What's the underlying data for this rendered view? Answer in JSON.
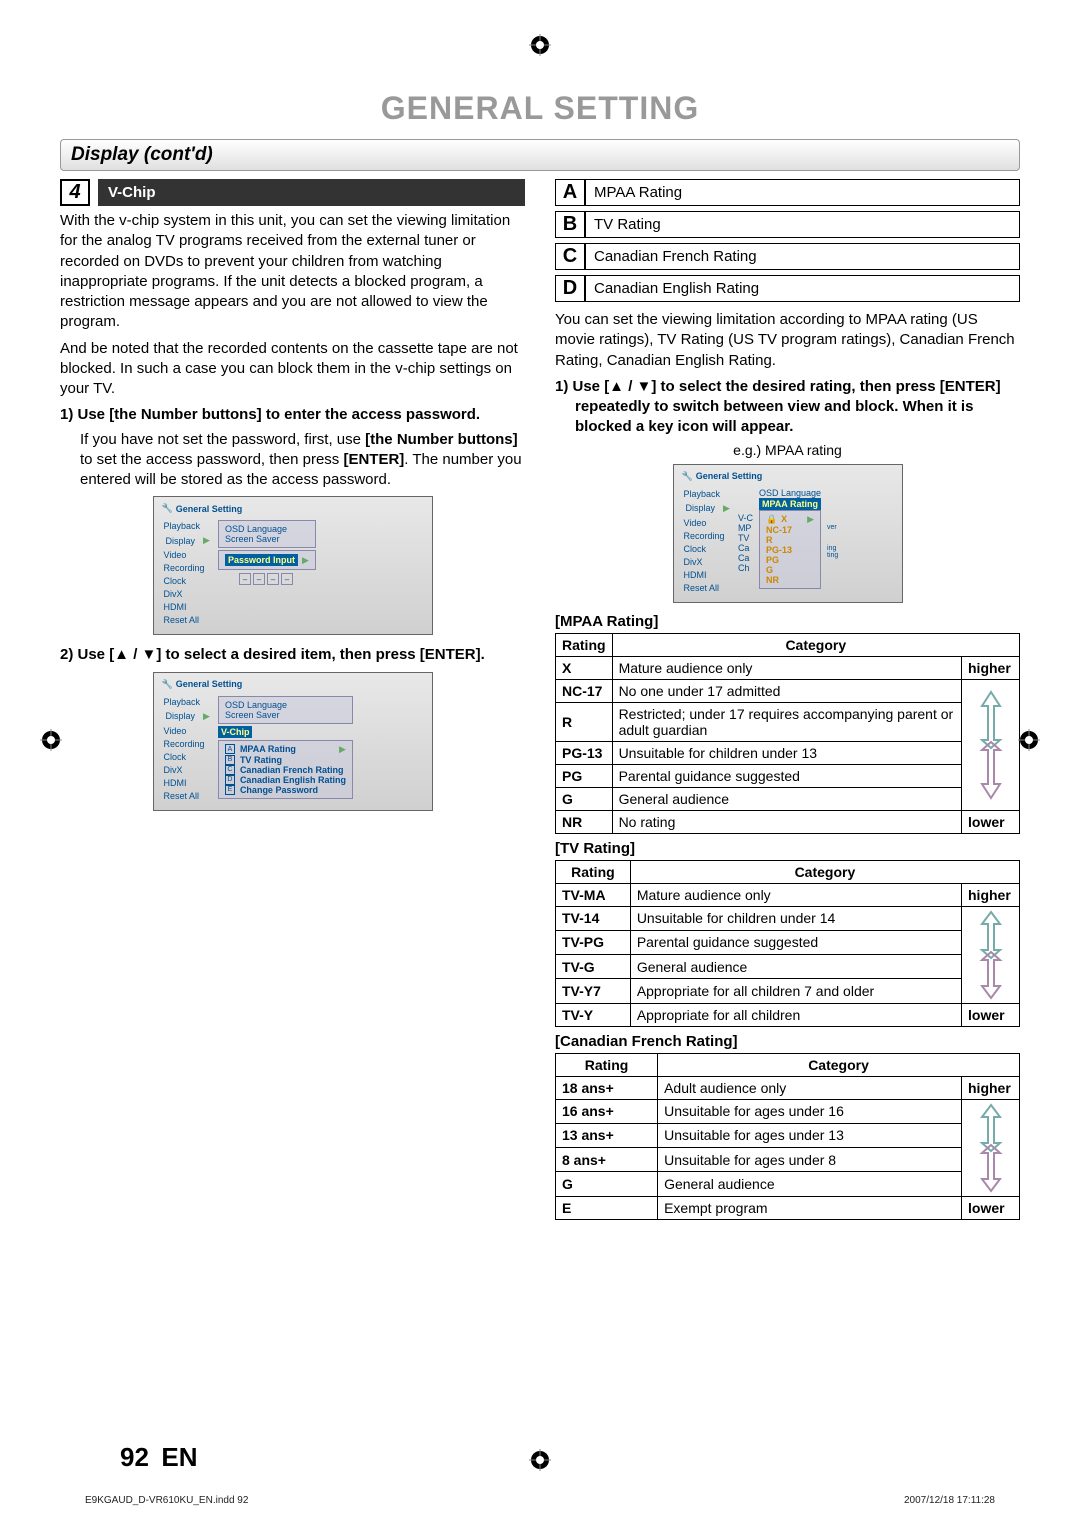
{
  "header": {
    "title": "GENERAL SETTING"
  },
  "section": {
    "title": "Display (cont'd)"
  },
  "step4": {
    "number": "4",
    "label": "V-Chip",
    "para1": "With the v-chip system in this unit, you can set the viewing limitation for the analog TV programs received from the external tuner or recorded on DVDs to prevent your children from watching inappropriate programs. If the unit detects a blocked program, a restriction message appears and you are not allowed to view the program.",
    "para2": "And be noted that the recorded contents on the cassette tape are not blocked. In such a case you can block them in the v-chip settings on your TV.",
    "step1": "1) Use [the Number buttons] to enter the access password.",
    "step1_body_a": "If you have not set the password, first, use ",
    "step1_body_b": "[the Number buttons]",
    "step1_body_c": " to set the access password, then press ",
    "step1_body_d": "[ENTER]",
    "step1_body_e": ". The number you entered will be stored as the access password.",
    "step2": "2) Use [▲ / ▼] to select a desired item, then press [ENTER]."
  },
  "osd": {
    "window": "General Setting",
    "menu": [
      "Playback",
      "Display",
      "Video",
      "Recording",
      "Clock",
      "DivX",
      "HDMI",
      "Reset All"
    ],
    "side": [
      "OSD Language",
      "Screen Saver"
    ],
    "pw_label": "Password Input",
    "vchip_label": "V-Chip",
    "vchip_items": [
      "MPAA Rating",
      "TV Rating",
      "Canadian French Rating",
      "Canadian English Rating",
      "Change Password"
    ],
    "letters": [
      "A",
      "B",
      "C",
      "D",
      "E"
    ],
    "mpaa_hl": "MPAA Rating",
    "mpaa_list": [
      "X",
      "NC-17",
      "R",
      "PG-13",
      "PG",
      "G",
      "NR"
    ],
    "mpaa_trunc": [
      "MP",
      "TV",
      "Ca",
      "Ca",
      "Ch"
    ],
    "trunc_right": [
      "ver",
      "ing",
      "ting"
    ]
  },
  "options": {
    "A": "MPAA Rating",
    "B": "TV Rating",
    "C": "Canadian French Rating",
    "D": "Canadian English Rating"
  },
  "right": {
    "para": "You can set the viewing limitation according to MPAA rating (US movie ratings), TV Rating (US TV program ratings), Canadian French Rating, Canadian English Rating.",
    "step": "1) Use [▲ / ▼] to select the desired rating, then press [ENTER] repeatedly to switch between view and block. When it is blocked a key icon will appear.",
    "eg": "e.g.) MPAA rating"
  },
  "tables": {
    "mpaa_title": "[MPAA Rating]",
    "tv_title": "[TV Rating]",
    "cfr_title": "[Canadian French Rating]",
    "headers": {
      "rating": "Rating",
      "category": "Category"
    },
    "higher": "higher",
    "lower": "lower",
    "mpaa": [
      {
        "r": "X",
        "c": "Mature audience only"
      },
      {
        "r": "NC-17",
        "c": "No one under 17 admitted"
      },
      {
        "r": "R",
        "c": "Restricted; under 17 requires accompanying parent or adult guardian"
      },
      {
        "r": "PG-13",
        "c": "Unsuitable for children under 13"
      },
      {
        "r": "PG",
        "c": "Parental guidance suggested"
      },
      {
        "r": "G",
        "c": "General audience"
      },
      {
        "r": "NR",
        "c": "No rating"
      }
    ],
    "tv": [
      {
        "r": "TV-MA",
        "c": "Mature audience only"
      },
      {
        "r": "TV-14",
        "c": "Unsuitable for children under 14"
      },
      {
        "r": "TV-PG",
        "c": "Parental guidance suggested"
      },
      {
        "r": "TV-G",
        "c": "General audience"
      },
      {
        "r": "TV-Y7",
        "c": "Appropriate for all children 7 and older"
      },
      {
        "r": "TV-Y",
        "c": "Appropriate for all children"
      }
    ],
    "cfr": [
      {
        "r": "18 ans+",
        "c": "Adult audience only"
      },
      {
        "r": "16 ans+",
        "c": "Unsuitable for ages under 16"
      },
      {
        "r": "13 ans+",
        "c": "Unsuitable for ages under 13"
      },
      {
        "r": "8 ans+",
        "c": "Unsuitable for ages under 8"
      },
      {
        "r": "G",
        "c": "General audience"
      },
      {
        "r": "E",
        "c": "Exempt program"
      }
    ]
  },
  "footer": {
    "page": "92",
    "lang": "EN",
    "file": "E9KGAUD_D-VR610KU_EN.indd   92",
    "date": "2007/12/18   17:11:28"
  }
}
